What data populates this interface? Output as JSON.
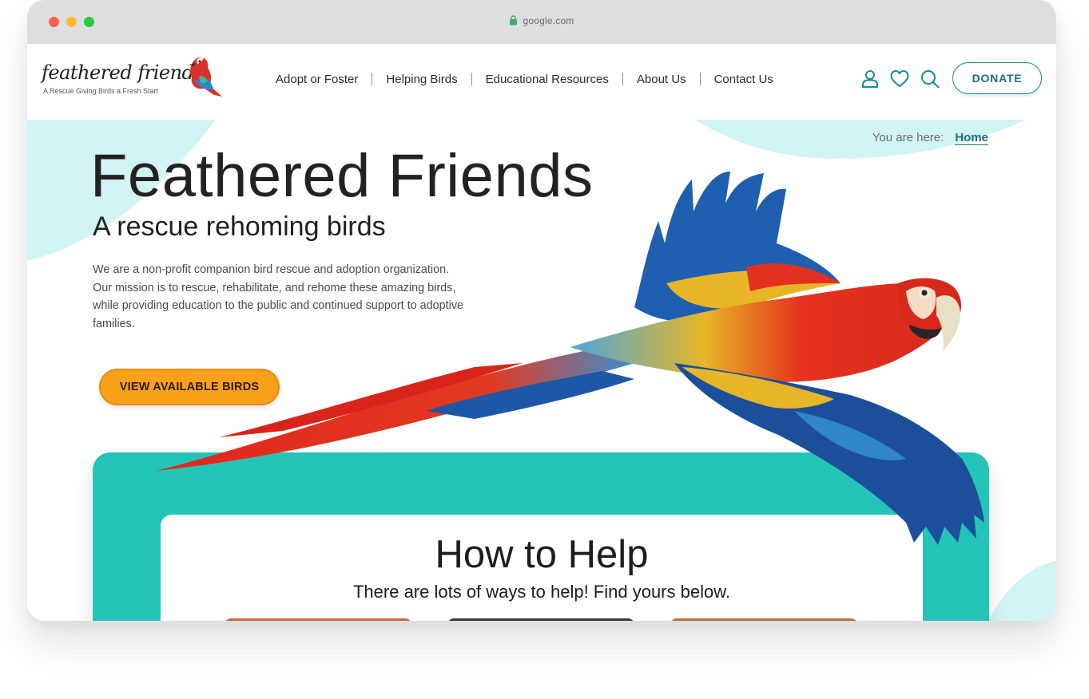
{
  "browser": {
    "url": "google.com"
  },
  "logo": {
    "name": "feathered friends",
    "tagline": "A Rescue Giving Birds a Fresh Start"
  },
  "nav": {
    "items": [
      {
        "label": "Adopt or Foster"
      },
      {
        "label": "Helping Birds"
      },
      {
        "label": "Educational Resources"
      },
      {
        "label": "About Us"
      },
      {
        "label": "Contact Us"
      }
    ]
  },
  "header": {
    "icons": [
      "user-icon",
      "heart-icon",
      "search-icon"
    ],
    "donate_label": "DONATE"
  },
  "breadcrumb": {
    "prefix": "You are here:",
    "current": "Home"
  },
  "hero": {
    "title": "Feathered Friends",
    "subtitle": "A rescue rehoming birds",
    "description": "We are a non-profit companion bird rescue and adoption organization. Our mission is to rescue, rehabilitate, and rehome these amazing birds, while providing education to the public and continued support to adoptive families.",
    "cta_label": "VIEW AVAILABLE BIRDS"
  },
  "help": {
    "title": "How to Help",
    "subtitle": "There are lots of ways to help! Find yours below."
  },
  "colors": {
    "teal": "#25c4b9",
    "teal_light": "#d2f4f2",
    "accent_dark": "#1b6f78",
    "orange": "#f9a01b"
  }
}
